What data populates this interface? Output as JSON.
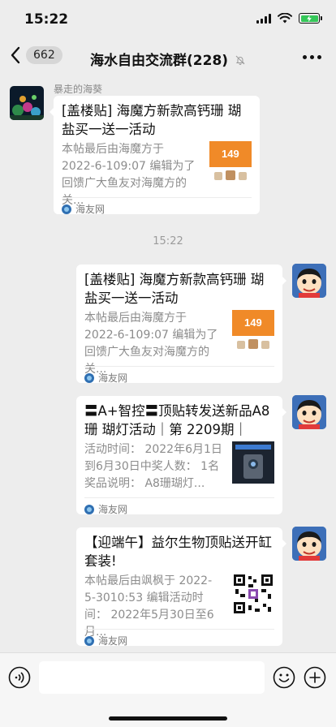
{
  "status_bar": {
    "time": "15:22"
  },
  "nav": {
    "unread_count": "662",
    "title": "海水自由交流群(228)",
    "mute_icon": "bell-slash-icon",
    "more_icon": "more-dots-icon"
  },
  "chat": {
    "messages": [
      {
        "sender": "暴走的海葵",
        "side": "left",
        "title": "[盖楼贴] 海魔方新款高钙珊 瑚盐买一送一活动",
        "desc": "本帖最后由海魔方于 2022-6-109:07 编辑为了回馈广大鱼友对海魔方的关...",
        "thumb_label": "149",
        "source": "海友网"
      },
      {
        "side": "right",
        "title": "[盖楼贴] 海魔方新款高钙珊 瑚盐买一送一活动",
        "desc": "本帖最后由海魔方于 2022-6-109:07 编辑为了回馈广大鱼友对海魔方的关...",
        "thumb_label": "149",
        "source": "海友网"
      },
      {
        "side": "right",
        "title": "〓A+智控〓顶贴转发送新品A8珊 瑚灯活动｜第 2209期｜",
        "desc": "活动时间： 2022年6月1日到6月30日中奖人数： 1名奖品说明： A8珊瑚灯...",
        "source": "海友网"
      },
      {
        "side": "right",
        "title": "【迎端午】益尔生物顶贴送开缸套装!",
        "desc": "本帖最后由飒枫于 2022-5-3010:53 编辑活动时间： 2022年5月30日至6月...",
        "source": "海友网"
      }
    ],
    "timestamp": "15:22"
  },
  "input_bar": {
    "voice_icon": "voice-icon",
    "emoji_icon": "emoji-icon",
    "plus_icon": "plus-icon"
  },
  "colors": {
    "background": "#ededed",
    "card": "#ffffff",
    "battery": "#35c759",
    "source_icon": "#2f6fb2"
  }
}
